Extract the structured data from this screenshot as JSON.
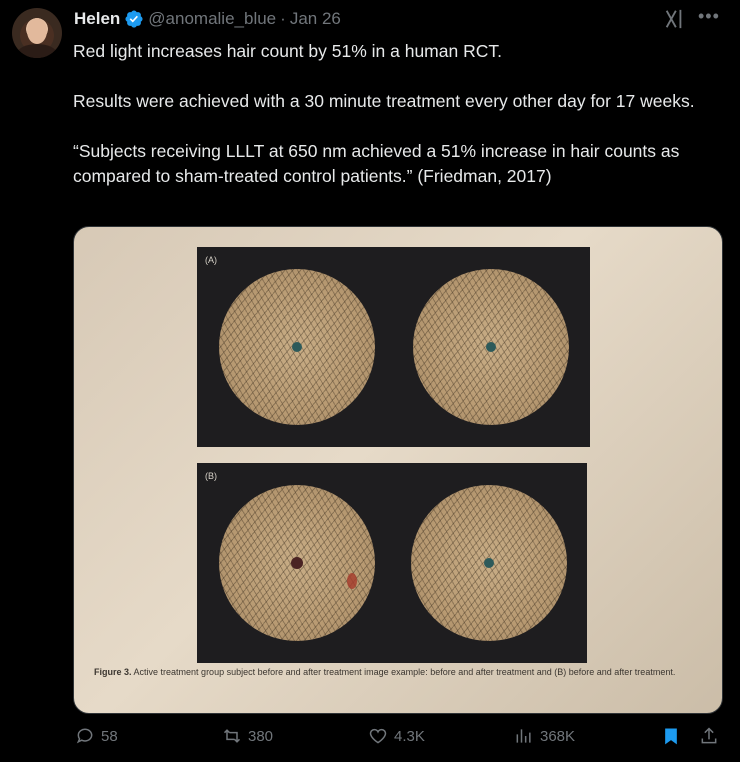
{
  "author": {
    "name": "Helen",
    "handle": "@anomalie_blue",
    "separator": "·",
    "date": "Jan 26"
  },
  "tweet": {
    "paragraphs": [
      "Red light increases hair count by 51% in a human RCT.",
      "Results were achieved with a 30 minute treatment every other day for 17 weeks.",
      "“Subjects receiving LLLT at 650 nm achieved a 51% increase in hair counts as compared to sham-treated control patients.” (Friedman, 2017)"
    ]
  },
  "media": {
    "panel_a_label": "(A)",
    "panel_b_label": "(B)",
    "caption_prefix": "Figure 3.",
    "caption": "Active treatment group subject before and after treatment image example: before and after treatment and (B) before and after treatment."
  },
  "actions": {
    "replies": "58",
    "reposts": "380",
    "likes": "4.3K",
    "views": "368K"
  },
  "icons": {
    "verified": "verified-badge-icon",
    "grok": "grok-icon",
    "more": "more-icon",
    "reply": "reply-icon",
    "repost": "repost-icon",
    "like": "heart-icon",
    "views": "views-icon",
    "bookmark": "bookmark-icon",
    "share": "share-icon"
  },
  "colors": {
    "background": "#000000",
    "text": "#e7e9ea",
    "muted": "#71767b",
    "verified": "#1d9bf0",
    "bookmark": "#1d9bf0"
  }
}
